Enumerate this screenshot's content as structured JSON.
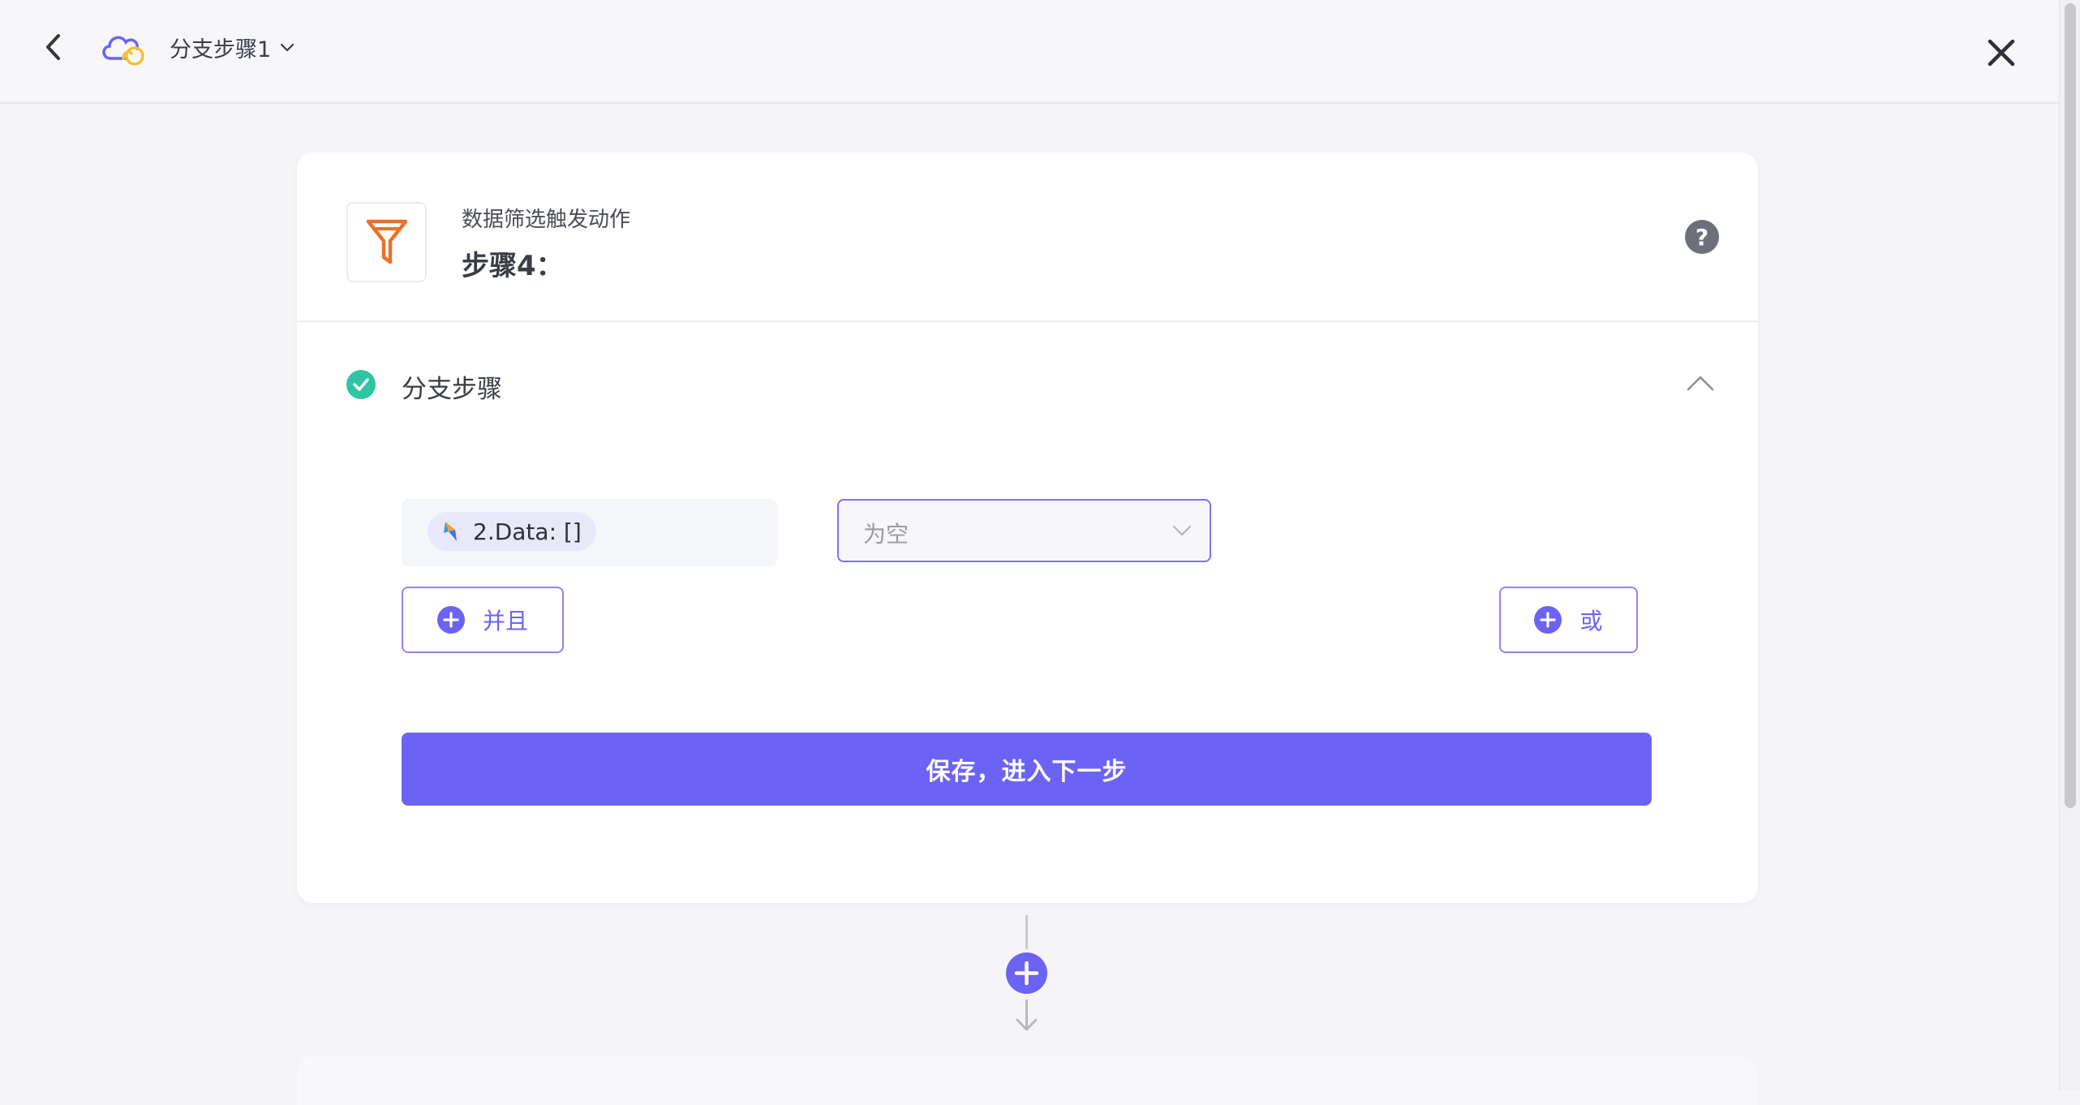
{
  "header": {
    "title": "分支步骤1",
    "back_icon": "chevron-left-icon",
    "logo_icon": "cloud-logo-icon",
    "dropdown_icon": "chevron-down-icon",
    "close_icon": "close-icon"
  },
  "card": {
    "subtitle": "数据筛选触发动作",
    "title": "步骤4：",
    "step_icon": "filter-icon",
    "help_label": "?"
  },
  "section": {
    "label": "分支步骤",
    "status_icon": "check-circle-icon",
    "collapse_icon": "chevron-up-icon"
  },
  "condition": {
    "field_chip": "2.Data: []",
    "operator_value": "为空"
  },
  "buttons": {
    "and_label": "并且",
    "or_label": "或",
    "save_label": "保存，进入下一步"
  },
  "colors": {
    "accent": "#6c63f5",
    "success": "#2ec5a4",
    "filter_icon": "#e8712b",
    "logo_secondary": "#f3c233"
  }
}
